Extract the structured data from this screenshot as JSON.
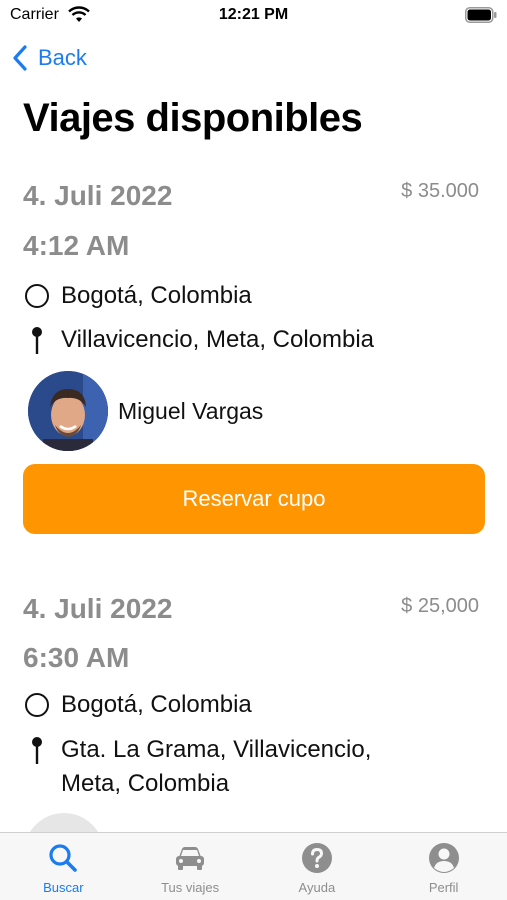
{
  "status_bar": {
    "carrier": "Carrier",
    "time": "12:21 PM"
  },
  "nav": {
    "back_label": "Back"
  },
  "page": {
    "title": "Viajes disponibles"
  },
  "trips": [
    {
      "date": "4. Juli 2022",
      "time": "4:12 AM",
      "price": "$ 35.000",
      "origin": "Bogotá, Colombia",
      "destination": "Villavicencio, Meta, Colombia",
      "driver": "Miguel Vargas",
      "button_label": "Reservar cupo"
    },
    {
      "date": "4. Juli 2022",
      "time": "6:30 AM",
      "price": "$ 25,000",
      "origin": "Bogotá, Colombia",
      "destination": "Gta. La Grama, Villavicencio, Meta, Colombia"
    }
  ],
  "tab_bar": {
    "tabs": [
      {
        "label": "Buscar",
        "icon": "search-icon",
        "active": true
      },
      {
        "label": "Tus viajes",
        "icon": "car-icon",
        "active": false
      },
      {
        "label": "Ayuda",
        "icon": "help-icon",
        "active": false
      },
      {
        "label": "Perfil",
        "icon": "profile-icon",
        "active": false
      }
    ]
  },
  "colors": {
    "accent": "#1a7cf0",
    "button": "#ff9500",
    "muted": "#8c8c8c"
  }
}
